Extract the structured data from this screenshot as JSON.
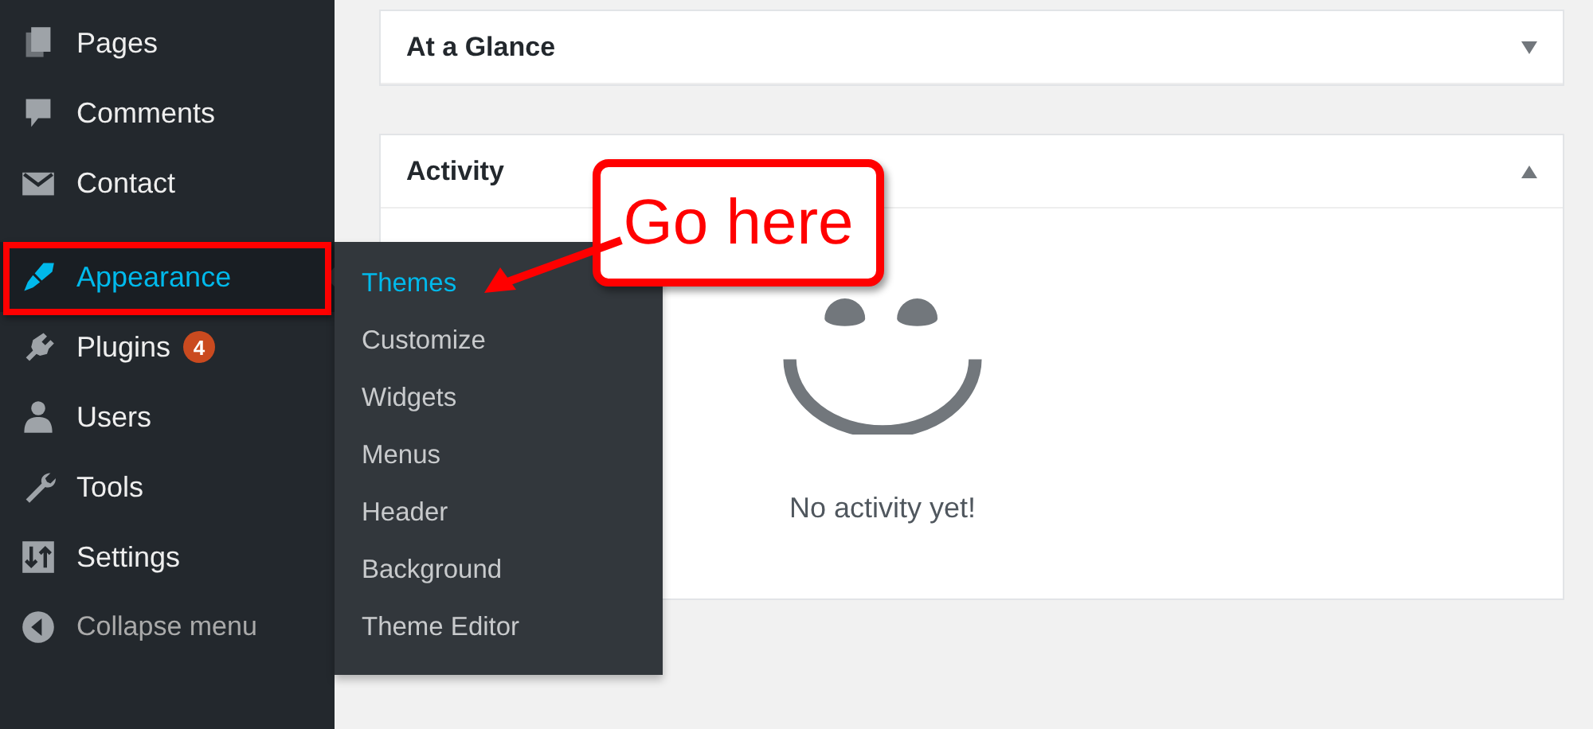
{
  "sidebar": {
    "items": [
      {
        "label": "Pages",
        "selected": false,
        "kind": "item"
      },
      {
        "label": "Comments",
        "selected": false,
        "kind": "item"
      },
      {
        "label": "Contact",
        "selected": false,
        "kind": "item"
      },
      {
        "label": "Appearance",
        "selected": true,
        "kind": "item"
      },
      {
        "label": "Plugins",
        "selected": false,
        "kind": "item",
        "badge": "4"
      },
      {
        "label": "Users",
        "selected": false,
        "kind": "item"
      },
      {
        "label": "Tools",
        "selected": false,
        "kind": "item"
      },
      {
        "label": "Settings",
        "selected": false,
        "kind": "item"
      },
      {
        "label": "Collapse menu",
        "selected": false,
        "kind": "collapse"
      }
    ]
  },
  "submenu": {
    "items": [
      {
        "label": "Themes",
        "selected": true
      },
      {
        "label": "Customize",
        "selected": false
      },
      {
        "label": "Widgets",
        "selected": false
      },
      {
        "label": "Menus",
        "selected": false
      },
      {
        "label": "Header",
        "selected": false
      },
      {
        "label": "Background",
        "selected": false
      },
      {
        "label": "Theme Editor",
        "selected": false
      }
    ]
  },
  "cards": [
    {
      "title": "At a Glance",
      "expanded": false
    },
    {
      "title": "Activity",
      "expanded": true,
      "empty_message": "No activity yet!"
    }
  ],
  "annotation": {
    "text": "Go here"
  }
}
